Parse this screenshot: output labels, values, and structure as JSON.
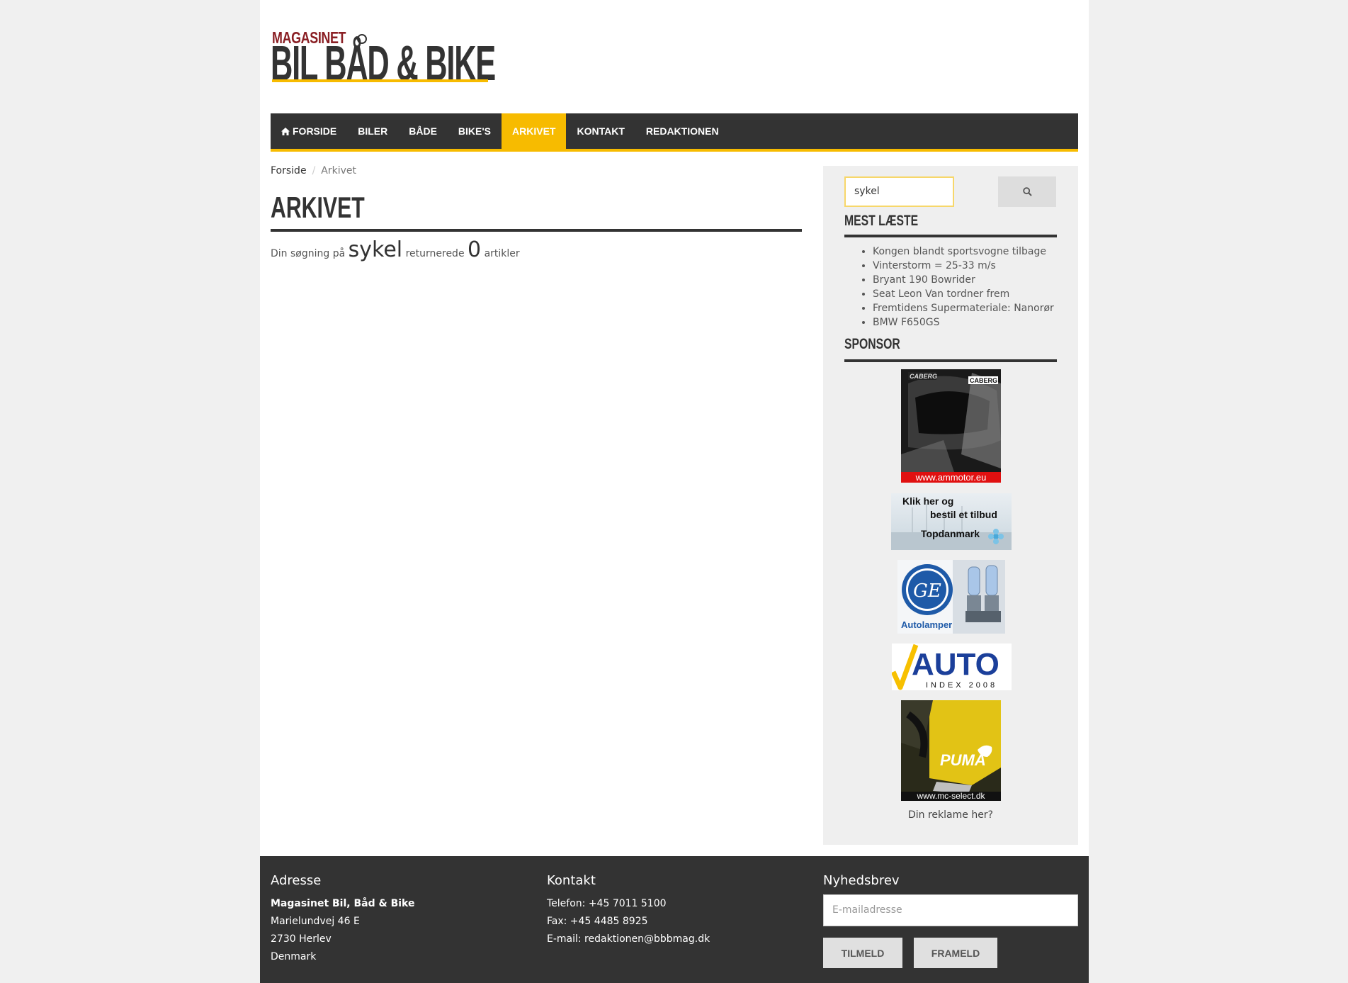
{
  "logo": {
    "top_text": "MAGASINET",
    "main_text": "BIL BÅD & BIKE"
  },
  "nav": {
    "items": [
      {
        "label": "FORSIDE",
        "icon": "home-icon"
      },
      {
        "label": "BILER"
      },
      {
        "label": "BÅDE"
      },
      {
        "label": "BIKE'S"
      },
      {
        "label": "ARKIVET",
        "active": true
      },
      {
        "label": "KONTAKT"
      },
      {
        "label": "REDAKTIONEN"
      }
    ],
    "accent_color": "#f7bb00",
    "bar_color": "#333333"
  },
  "breadcrumb": {
    "home": "Forside",
    "current": "Arkivet"
  },
  "main": {
    "title": "ARKIVET",
    "result_prefix": "Din søgning på",
    "query": "sykel",
    "result_middle": "returnerede",
    "count": "0",
    "result_suffix": "artikler"
  },
  "sidebar": {
    "search_value": "sykel",
    "search_icon": "search-icon",
    "most_read_title": "MEST LÆSTE",
    "most_read": [
      "Kongen blandt sportsvogne tilbage",
      "Vinterstorm = 25-33 m/s",
      "Bryant 190 Bowrider",
      "Seat Leon Van tordner frem",
      "Fremtidens Supermateriale: Nanorør",
      "BMW F650GS"
    ],
    "sponsor_title": "SPONSOR",
    "ads": {
      "caberg": {
        "brand": "CABERG",
        "url": "www.ammotor.eu"
      },
      "topdanmark": {
        "line1": "Klik her og",
        "line2": "bestil et tilbud",
        "brand": "Topdanmark"
      },
      "ge": {
        "logo": "GE",
        "caption": "Autolamper"
      },
      "autoindex": {
        "word": "AUTO",
        "sub": "INDEX 2008"
      },
      "puma": {
        "brand": "PUMA",
        "url": "www.mc-select.dk"
      }
    },
    "ad_link": "Din reklame her?"
  },
  "footer": {
    "address": {
      "heading": "Adresse",
      "name": "Magasinet Bil, Båd & Bike",
      "street": "Marielundvej 46 E",
      "city": "2730 Herlev",
      "country": "Denmark"
    },
    "contact": {
      "heading": "Kontakt",
      "phone": "Telefon: +45 7011 5100",
      "fax": "Fax: +45 4485 8925",
      "email": "E-mail: redaktionen@bbbmag.dk"
    },
    "newsletter": {
      "heading": "Nyhedsbrev",
      "placeholder": "E-mailadresse",
      "subscribe": "TILMELD",
      "unsubscribe": "FRAMELD"
    }
  }
}
